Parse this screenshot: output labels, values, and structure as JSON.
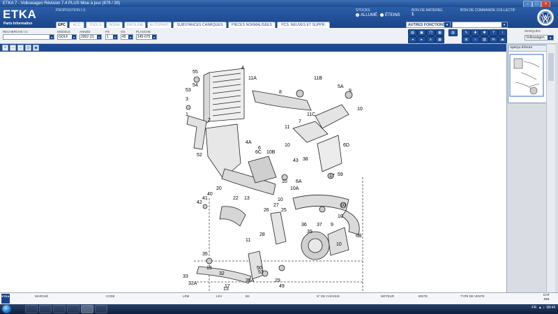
{
  "window": {
    "title": "ETKA 7 - Volkswagen Révision 7.4 PLUS Mise à jour (879 / 39)"
  },
  "header": {
    "logo": "ETKA",
    "logo_sub": "Parts Information",
    "proposition": "PROPOSITION I.V.",
    "stocks_label": "STOCKS",
    "stock_on": "ALLUMÉ",
    "stock_off": "ÉTEINS",
    "bon_label": "BON DE MATERIEL",
    "bon_value": "1",
    "bon_coll_label": "BON DE COMMANDE COLLECTIF"
  },
  "tabs": [
    {
      "label": "EPC",
      "state": "active"
    },
    {
      "label": "ACC",
      "state": "dim"
    },
    {
      "label": "TOOLS",
      "state": "dim"
    },
    {
      "label": "NORA",
      "state": "dim"
    },
    {
      "label": "INFOLINE",
      "state": "dim"
    },
    {
      "label": "AUTOPART",
      "state": "dim"
    },
    {
      "label": "SUBSTANCES CHIMIQUES",
      "state": "normal"
    },
    {
      "label": "PIÈCES NORMALISÉES",
      "state": "normal"
    },
    {
      "label": "PCS. NEUVES ET SUPPR.",
      "state": "normal"
    }
  ],
  "autres_fonctions": "AUTRES FONCTIONS",
  "form": {
    "recherche_label": "RECHERCHE I.V.",
    "recherche_value": "",
    "modele_label": "MODÈLE",
    "modele_value": "GOLF",
    "annee_label": "ANNÉE",
    "annee_value": "2002 (2)",
    "ps_label": "PS",
    "ps_value": "1",
    "gs_label": "GS",
    "gs_value": "45",
    "planche_label": "PLANCHE",
    "planche_value": "145-075"
  },
  "marques": {
    "label": "MARQUES",
    "value": "Volkswagen"
  },
  "preview": {
    "title": "Aperçu d'écran"
  },
  "bottom": {
    "columns": [
      "MARCHÉ",
      "CODE",
      "LRM",
      "LEV",
      "BS",
      "N° DE CHÂSSIS",
      "MOTEUR",
      "BOITE",
      "TYPE DE VENTE"
    ],
    "cat_label": "CAT",
    "cat_value": "266",
    "left_badge": "ETKA"
  },
  "taskbar": {
    "lang": "FR",
    "time": "08:44"
  },
  "diagram": {
    "labels": [
      "55",
      "4",
      "54",
      "53",
      "3",
      "11A",
      "8",
      "11B",
      "5A",
      "9",
      "10",
      "2",
      "1",
      "11C",
      "11",
      "7",
      "10",
      "4A",
      "6",
      "52",
      "6C",
      "10B",
      "6D",
      "43",
      "38",
      "10",
      "6A",
      "59",
      "17",
      "20",
      "10",
      "10A",
      "42",
      "41",
      "40",
      "22",
      "13",
      "26",
      "25",
      "27",
      "10",
      "39",
      "37",
      "36",
      "9",
      "10",
      "11",
      "28",
      "6B",
      "10",
      "35",
      "15",
      "50",
      "32",
      "17",
      "35A",
      "51",
      "29",
      "33",
      "32A",
      "49",
      "13"
    ]
  },
  "accent": "#1a4489"
}
